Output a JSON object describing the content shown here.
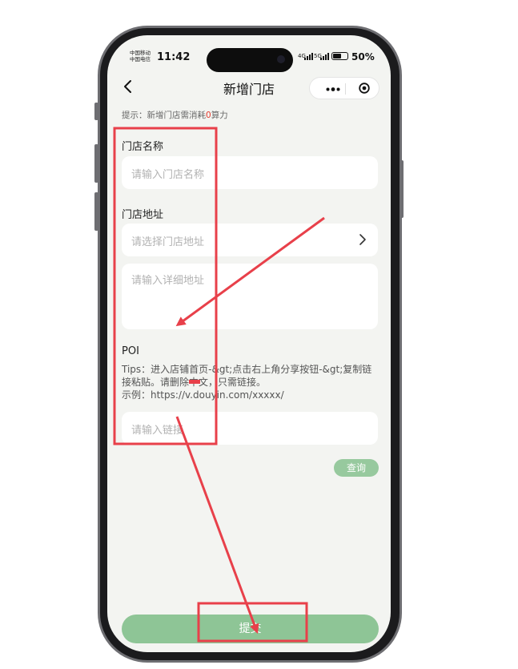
{
  "status_bar": {
    "carrier_1": "中国移动",
    "carrier_2": "中国电信",
    "time": "11:42",
    "network_1": "4G",
    "network_2": "5G",
    "battery": "50%",
    "battery_level": 0.5
  },
  "nav": {
    "title": "新增门店",
    "back_icon": "chevron-left-icon",
    "more_icon": "more-dots-icon",
    "close_icon": "target-circle-icon"
  },
  "hint": {
    "prefix": "提示：新增门店需消耗",
    "count": "0",
    "suffix": "算力"
  },
  "form": {
    "store_name_label": "门店名称",
    "store_name_placeholder": "请输入门店名称",
    "store_address_label": "门店地址",
    "store_address_placeholder": "请选择门店地址",
    "detail_address_placeholder": "请输入详细地址",
    "poi_label": "POI",
    "poi_tips": "Tips：进入店铺首页-&gt;点击右上角分享按钮-&gt;复制链接粘贴。请删除中文，只需链接。",
    "poi_example": "示例：https://v.douyin.com/xxxxx/",
    "link_placeholder": "请输入链接",
    "query_button": "查询",
    "submit_button": "提交"
  },
  "colors": {
    "accent_green": "#8ec596",
    "annotation_red": "#e8404a",
    "hint_red": "#e23b2d"
  }
}
